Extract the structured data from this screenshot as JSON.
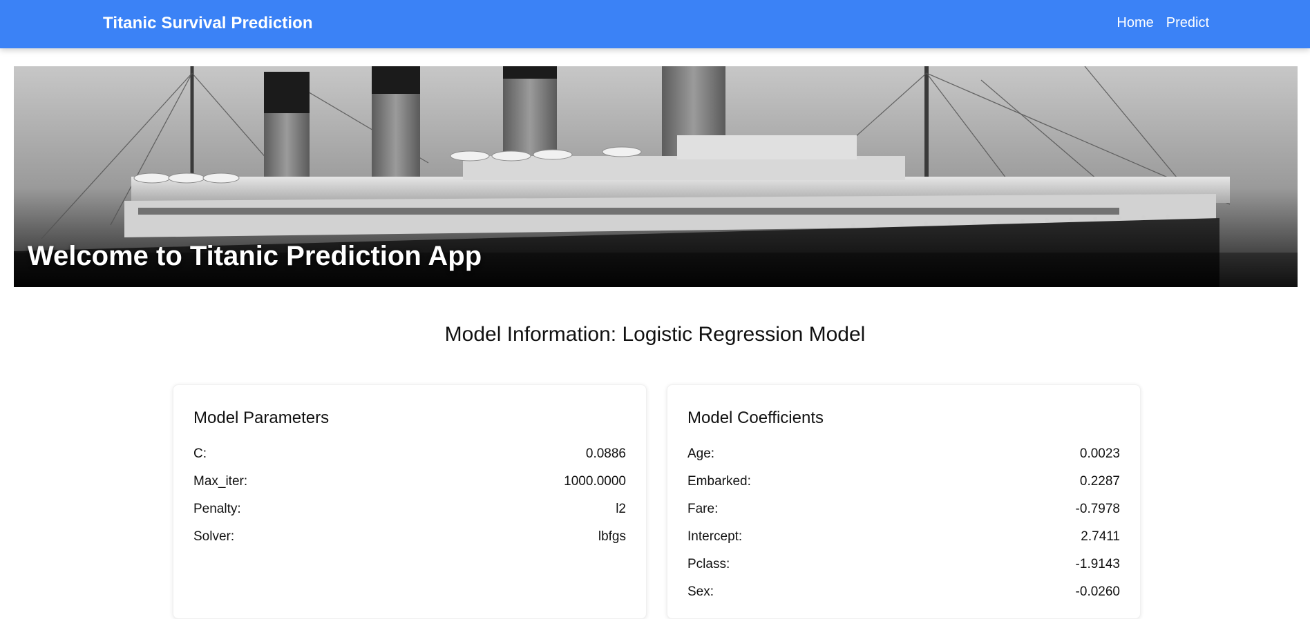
{
  "navbar": {
    "brand": "Titanic Survival Prediction",
    "links": [
      "Home",
      "Predict"
    ],
    "color": "#3b82f6"
  },
  "hero": {
    "title": "Welcome to Titanic Prediction App"
  },
  "section": {
    "title": "Model Information: Logistic Regression Model"
  },
  "params": {
    "title": "Model Parameters",
    "rows": [
      {
        "label": "C:",
        "value": "0.0886"
      },
      {
        "label": "Max_iter:",
        "value": "1000.0000"
      },
      {
        "label": "Penalty:",
        "value": "l2"
      },
      {
        "label": "Solver:",
        "value": "lbfgs"
      }
    ]
  },
  "coefficients": {
    "title": "Model Coefficients",
    "rows": [
      {
        "label": "Age:",
        "value": "0.0023"
      },
      {
        "label": "Embarked:",
        "value": "0.2287"
      },
      {
        "label": "Fare:",
        "value": "-0.7978"
      },
      {
        "label": "Intercept:",
        "value": "2.7411"
      },
      {
        "label": "Pclass:",
        "value": "-1.9143"
      },
      {
        "label": "Sex:",
        "value": "-0.0260"
      }
    ]
  }
}
